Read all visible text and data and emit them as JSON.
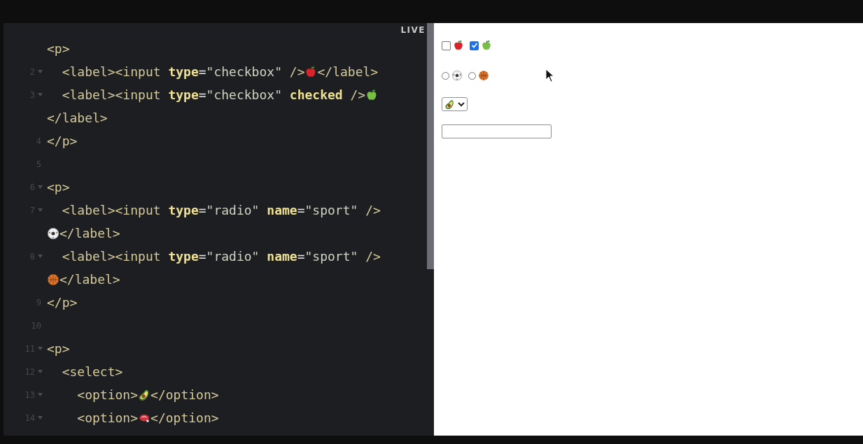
{
  "editor": {
    "badge": "LIVE",
    "lines": [
      {
        "fold": false,
        "tokens": [
          {
            "kind": "tag",
            "text": "<p>"
          }
        ]
      },
      {
        "number": "2",
        "fold": true,
        "tokens": [
          {
            "kind": "tag",
            "text": "  <label><input "
          },
          {
            "kind": "attr",
            "text": "type"
          },
          {
            "kind": "punct",
            "text": "="
          },
          {
            "kind": "str",
            "text": "\"checkbox\""
          },
          {
            "kind": "tag",
            "text": " />"
          },
          {
            "kind": "redapple"
          },
          {
            "kind": "tag",
            "text": "</label>"
          }
        ]
      },
      {
        "number": "3",
        "fold": true,
        "tokens": [
          {
            "kind": "tag",
            "text": "  <label><input "
          },
          {
            "kind": "attr",
            "text": "type"
          },
          {
            "kind": "punct",
            "text": "="
          },
          {
            "kind": "str",
            "text": "\"checkbox\""
          },
          {
            "kind": "attr",
            "text": " checked"
          },
          {
            "kind": "tag",
            "text": " />"
          },
          {
            "kind": "greenapple"
          }
        ]
      },
      {
        "fold": false,
        "tokens": [
          {
            "kind": "tag",
            "text": "</label>"
          }
        ]
      },
      {
        "number": "4",
        "fold": false,
        "tokens": [
          {
            "kind": "tag",
            "text": "</p>"
          }
        ]
      },
      {
        "number": "5",
        "fold": false
      },
      {
        "number": "6",
        "fold": true,
        "tokens": [
          {
            "kind": "tag",
            "text": "<p>"
          }
        ]
      },
      {
        "number": "7",
        "fold": true,
        "tokens": [
          {
            "kind": "tag",
            "text": "  <label><input "
          },
          {
            "kind": "attr",
            "text": "type"
          },
          {
            "kind": "punct",
            "text": "="
          },
          {
            "kind": "str",
            "text": "\"radio\""
          },
          {
            "kind": "attr",
            "text": " name"
          },
          {
            "kind": "punct",
            "text": "="
          },
          {
            "kind": "str",
            "text": "\"sport\""
          },
          {
            "kind": "tag",
            "text": " />"
          }
        ]
      },
      {
        "fold": false,
        "tokens": [
          {
            "kind": "soccerball"
          },
          {
            "kind": "tag",
            "text": "</label>"
          }
        ]
      },
      {
        "number": "8",
        "fold": true,
        "tokens": [
          {
            "kind": "tag",
            "text": "  <label><input "
          },
          {
            "kind": "attr",
            "text": "type"
          },
          {
            "kind": "punct",
            "text": "="
          },
          {
            "kind": "str",
            "text": "\"radio\""
          },
          {
            "kind": "attr",
            "text": " name"
          },
          {
            "kind": "punct",
            "text": "="
          },
          {
            "kind": "str",
            "text": "\"sport\""
          },
          {
            "kind": "tag",
            "text": " />"
          }
        ]
      },
      {
        "fold": false,
        "tokens": [
          {
            "kind": "basketball"
          },
          {
            "kind": "tag",
            "text": "</label>"
          }
        ]
      },
      {
        "number": "9",
        "fold": false,
        "tokens": [
          {
            "kind": "tag",
            "text": "</p>"
          }
        ]
      },
      {
        "number": "10",
        "fold": false
      },
      {
        "number": "11",
        "fold": true,
        "tokens": [
          {
            "kind": "tag",
            "text": "<p>"
          }
        ]
      },
      {
        "number": "12",
        "fold": true,
        "tokens": [
          {
            "kind": "tag",
            "text": "  <select>"
          }
        ]
      },
      {
        "number": "13",
        "fold": true,
        "tokens": [
          {
            "kind": "tag",
            "text": "    <option>"
          },
          {
            "kind": "avocado"
          },
          {
            "kind": "tag",
            "text": "</option>"
          }
        ]
      },
      {
        "number": "14",
        "fold": true,
        "tokens": [
          {
            "kind": "tag",
            "text": "    <option>"
          },
          {
            "kind": "meat"
          },
          {
            "kind": "tag",
            "text": "</option>"
          }
        ]
      }
    ]
  },
  "preview": {
    "checkboxes": [
      {
        "checked": false,
        "kind": "redapple"
      },
      {
        "checked": true,
        "kind": "greenapple"
      }
    ],
    "radios": [
      {
        "selected": false,
        "kind": "soccerball"
      },
      {
        "selected": false,
        "kind": "basketball"
      }
    ],
    "select": {
      "kind": "avocado"
    }
  }
}
